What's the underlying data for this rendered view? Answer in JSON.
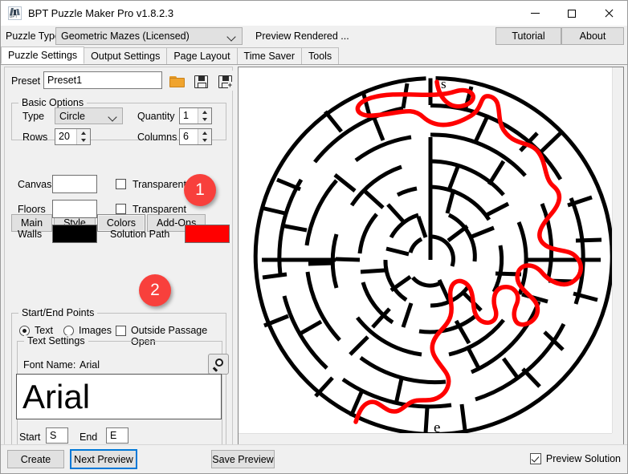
{
  "window": {
    "title": "BPT Puzzle Maker Pro v1.8.2.3",
    "icon": "app-icon",
    "minimize": "—",
    "maximize": "□",
    "close": "✕"
  },
  "toolbar": {
    "puzzle_type_label": "Puzzle Type",
    "puzzle_type_value": "Geometric Mazes (Licensed)",
    "preview_status": "Preview Rendered ...",
    "tutorial_label": "Tutorial",
    "about_label": "About"
  },
  "tabs": [
    {
      "label": "Puzzle Settings",
      "active": true
    },
    {
      "label": "Output Settings",
      "active": false
    },
    {
      "label": "Page Layout",
      "active": false
    },
    {
      "label": "Time Saver",
      "active": false
    },
    {
      "label": "Tools",
      "active": false
    }
  ],
  "preset": {
    "label": "Preset",
    "value": "Preset1",
    "open_icon": "folder-open-icon",
    "save_icon": "floppy-save-icon",
    "save_as_icon": "floppy-save-as-icon"
  },
  "basic_options": {
    "title": "Basic Options",
    "type_label": "Type",
    "type_value": "Circle",
    "quantity_label": "Quantity",
    "quantity_value": "1",
    "rows_label": "Rows",
    "rows_value": "20",
    "columns_label": "Columns",
    "columns_value": "6"
  },
  "subtabs": [
    {
      "label": "Main",
      "active": false
    },
    {
      "label": "Style",
      "active": false
    },
    {
      "label": "Colors",
      "active": true
    },
    {
      "label": "Add-Ons",
      "active": false
    }
  ],
  "colors": {
    "canvas_label": "Canvas",
    "canvas_color": "#ffffff",
    "canvas_transparent_label": "Transparent",
    "canvas_transparent_checked": false,
    "floors_label": "Floors",
    "floors_color": "#ffffff",
    "floors_transparent_label": "Transparent",
    "floors_transparent_checked": false,
    "walls_label": "Walls",
    "walls_color": "#000000",
    "solution_path_label": "Solution Path",
    "solution_path_color": "#ff0000"
  },
  "start_end": {
    "title": "Start/End Points",
    "text_radio_label": "Text",
    "images_radio_label": "Images",
    "mode": "Text",
    "outside_passage_label": "Outside Passage Open",
    "outside_passage_checked": false,
    "text_settings_title": "Text Settings",
    "font_name_label": "Font Name:",
    "font_name_value": "Arial",
    "font_picker_icon": "magnifier-icon",
    "font_preview_text": "Arial",
    "start_label": "Start",
    "start_value": "S",
    "end_label": "End",
    "end_value": "E"
  },
  "annotations": [
    {
      "number": "1",
      "color": "#f8403c"
    },
    {
      "number": "2",
      "color": "#f8403c"
    }
  ],
  "preview": {
    "maze_type": "circular-maze",
    "start_marker": "s",
    "end_marker": "e",
    "wall_color": "#000000",
    "solution_color": "#ff0000",
    "background_color": "#ffffff"
  },
  "bottom": {
    "create_label": "Create",
    "next_preview_label": "Next Preview",
    "save_preview_label": "Save Preview",
    "preview_solution_label": "Preview Solution",
    "preview_solution_checked": true
  }
}
